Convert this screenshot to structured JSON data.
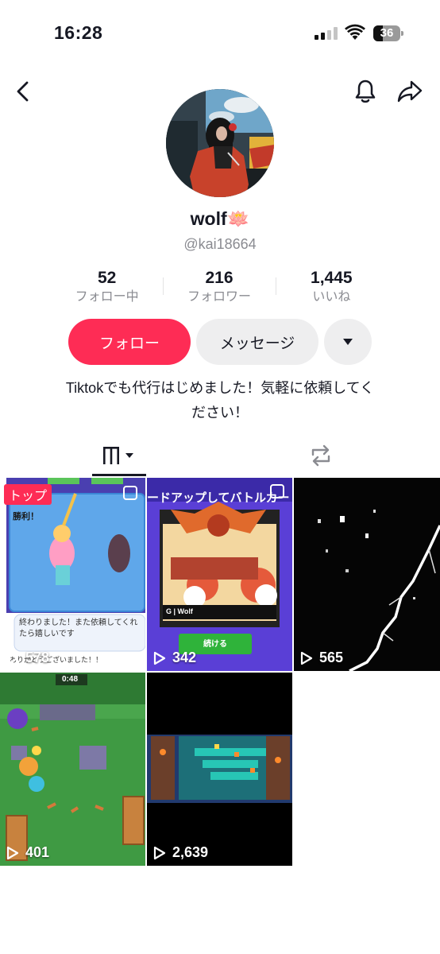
{
  "status_bar": {
    "time": "16:28",
    "battery": "36",
    "battery_level": 0.36
  },
  "icons": {
    "back": "back-arrow-icon",
    "bell": "bell-icon",
    "share": "share-icon",
    "dropdown": "caret-down-icon",
    "grid_tab": "grid-bars-icon",
    "repost_tab": "repost-icon"
  },
  "profile": {
    "name": "wolf",
    "name_emoji": "🪷",
    "handle": "@kai18664",
    "stats": [
      {
        "value": "52",
        "label": "フォロー中"
      },
      {
        "value": "216",
        "label": "フォロワー"
      },
      {
        "value": "1,445",
        "label": "いいね"
      }
    ],
    "bio_line1": "Tiktokでも代行はじめました！気軽に依頼してく",
    "bio_line2": "ださい！"
  },
  "actions": {
    "follow": "フォロー",
    "message": "メッセージ"
  },
  "colors": {
    "accent": "#fe2c55",
    "secondary_button": "#eeeeef",
    "muted_text": "#8a8b91"
  },
  "videos": [
    {
      "views": "578",
      "badge": "トップ",
      "caption_top": "勝利！",
      "caption_chat": "終わりました！また依頼してくれたら嬉しいです",
      "caption_bottom": "ありがとうございました！！"
    },
    {
      "views": "342",
      "caption_top": "ードアップしてバトルカードに",
      "button": "続ける",
      "tag": "G | Wolf"
    },
    {
      "views": "565"
    },
    {
      "views": "401",
      "timer": "0:48"
    },
    {
      "views": "2,639"
    }
  ]
}
